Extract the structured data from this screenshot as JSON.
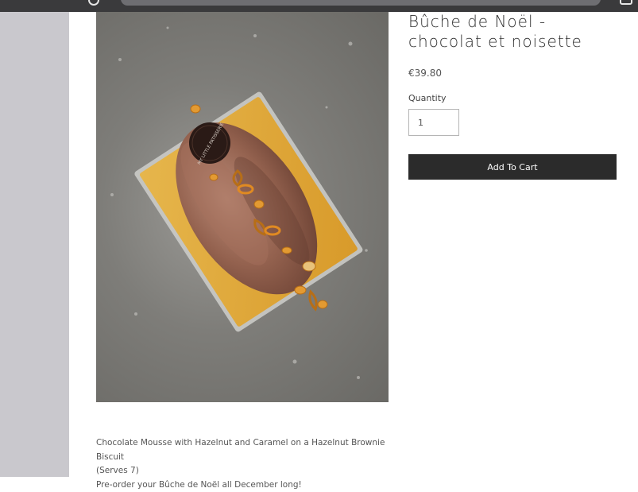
{
  "product": {
    "title": "Bûche de Noël - chocolat et noisette",
    "price": "€39.80",
    "quantity_label": "Quantity",
    "quantity_value": "1",
    "add_to_cart_label": "Add To Cart",
    "image_logo_text": "MY LITTLE PATISSERIE",
    "description": {
      "line1": "Chocolate Mousse with Hazelnut and Caramel on a Hazelnut Brownie Biscuit",
      "line2": "(Serves 7)",
      "line3": "Pre-order your Bûche de Noël all December long!"
    }
  },
  "colors": {
    "button_bg": "#2b2b2b",
    "sidebar_bg": "#c9c8cd",
    "topbar_bg": "#3a3a3c"
  }
}
